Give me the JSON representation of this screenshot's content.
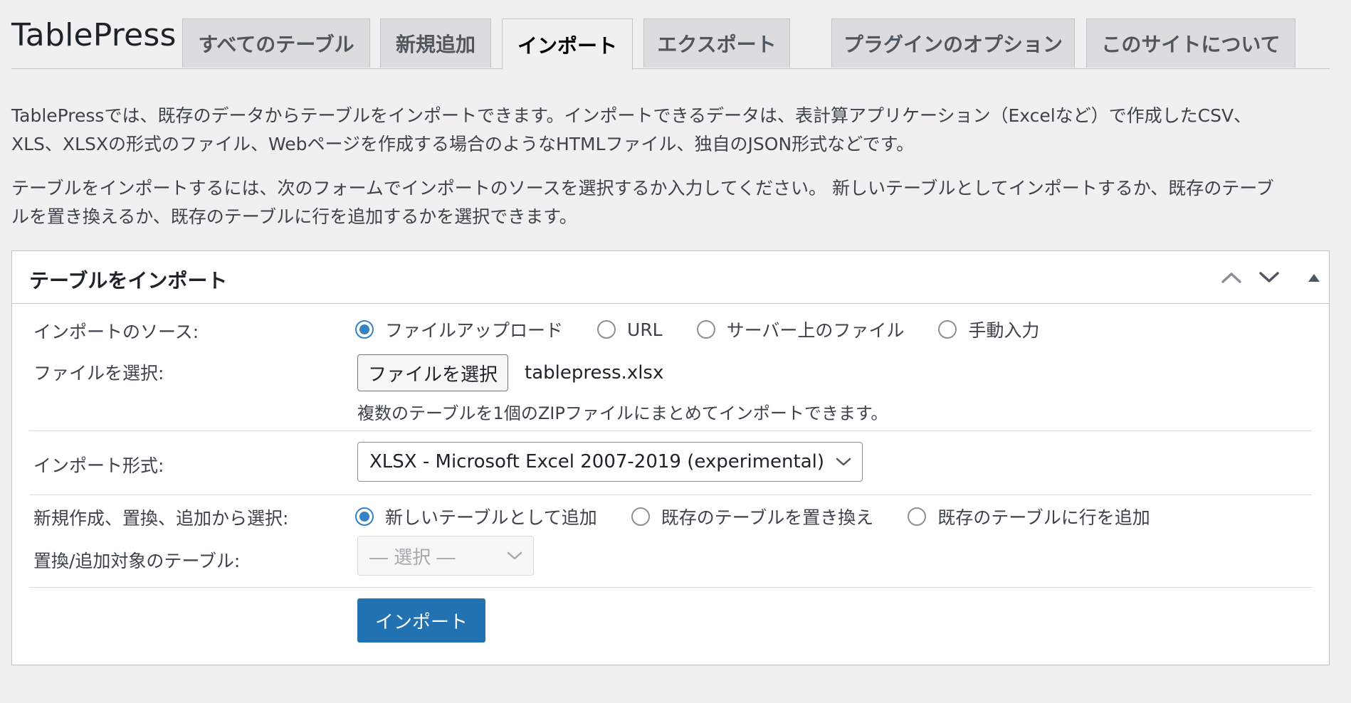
{
  "header": {
    "app_title": "TablePress",
    "tabs": [
      {
        "label": "すべてのテーブル",
        "active": false
      },
      {
        "label": "新規追加",
        "active": false
      },
      {
        "label": "インポート",
        "active": true
      },
      {
        "label": "エクスポート",
        "active": false
      },
      {
        "label": "プラグインのオプション",
        "active": false
      },
      {
        "label": "このサイトについて",
        "active": false
      }
    ]
  },
  "intro": {
    "p1_line1": "TablePressでは、既存のデータからテーブルをインポートできます。インポートできるデータは、表計算アプリケーション（Excelなど）で作成したCSV、",
    "p1_line2": "XLS、XLSXの形式のファイル、Webページを作成する場合のようなHTMLファイル、独自のJSON形式などです。",
    "p2_line1": "テーブルをインポートするには、次のフォームでインポートのソースを選択するか入力してください。 新しいテーブルとしてインポートするか、既存のテーブ",
    "p2_line2": "ルを置き換えるか、既存のテーブルに行を追加するかを選択できます。"
  },
  "panel": {
    "title": "テーブルをインポート",
    "import_source": {
      "label": "インポートのソース:",
      "options": [
        "ファイルアップロード",
        "URL",
        "サーバー上のファイル",
        "手動入力"
      ],
      "selected": 0
    },
    "file": {
      "label": "ファイルを選択:",
      "button_label": "ファイルを選択",
      "file_name": "tablepress.xlsx",
      "hint": "複数のテーブルを1個のZIPファイルにまとめてインポートできます。"
    },
    "import_format": {
      "label": "インポート形式:",
      "selected": "XLSX - Microsoft Excel 2007-2019 (experimental)"
    },
    "import_type": {
      "label": "新規作成、置換、追加から選択:",
      "options": [
        "新しいテーブルとして追加",
        "既存のテーブルを置き換え",
        "既存のテーブルに行を追加"
      ],
      "selected": 0
    },
    "target_table": {
      "label": "置換/追加対象のテーブル:",
      "selected": "― 選択 ―"
    },
    "submit_label": "インポート"
  },
  "colors": {
    "primary": "#2271b1",
    "radio_checked": "#3582c4",
    "background": "#f0f0f1"
  }
}
